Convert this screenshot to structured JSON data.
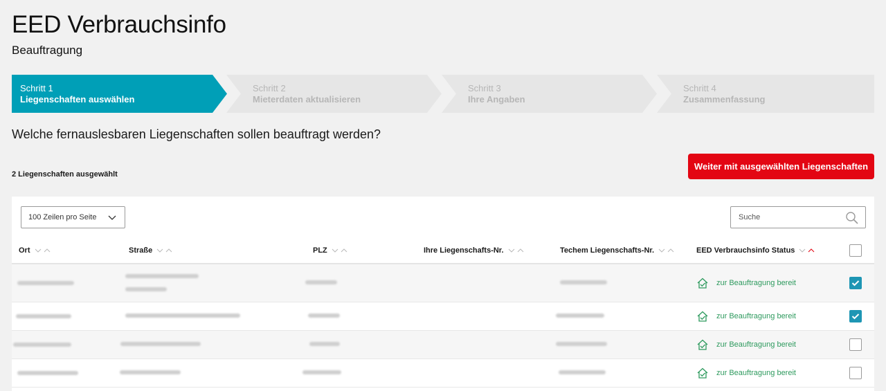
{
  "header": {
    "title": "EED Verbrauchsinfo",
    "subtitle": "Beauftragung"
  },
  "steps": [
    {
      "num": "Schritt 1",
      "label": "Liegenschaften auswählen",
      "active": true
    },
    {
      "num": "Schritt 2",
      "label": "Mieterdaten aktualisieren",
      "active": false
    },
    {
      "num": "Schritt 3",
      "label": "Ihre Angaben",
      "active": false
    },
    {
      "num": "Schritt 4",
      "label": "Zusammenfassung",
      "active": false
    }
  ],
  "question": "Welche fernauslesbaren Liegenschaften sollen beauftragt werden?",
  "selected_count": "2 Liegenschaften ausgewählt",
  "continue_button": "Weiter mit ausgewählten Liegenschaften",
  "table_controls": {
    "rows_per_page": "100 Zeilen pro Seite",
    "search_placeholder": "Suche"
  },
  "columns": [
    "Ort",
    "Straße",
    "PLZ",
    "Ihre Liegenschafts-Nr.",
    "Techem Liegenschafts-Nr.",
    "EED Verbrauchsinfo Status"
  ],
  "rows": [
    {
      "status": "zur Beauftragung bereit",
      "selected": true
    },
    {
      "status": "zur Beauftragung bereit",
      "selected": true
    },
    {
      "status": "zur Beauftragung bereit",
      "selected": false
    },
    {
      "status": "zur Beauftragung bereit",
      "selected": false
    }
  ],
  "colors": {
    "accent": "#009fb7",
    "primary_button": "#e30613",
    "status_ready": "#2e9a5e",
    "checkbox_checked": "#1e96b4"
  },
  "icons": {
    "sort": "sort-chevrons-icon",
    "status": "house-check-icon",
    "search": "search-icon",
    "dropdown": "chevron-down-icon"
  }
}
